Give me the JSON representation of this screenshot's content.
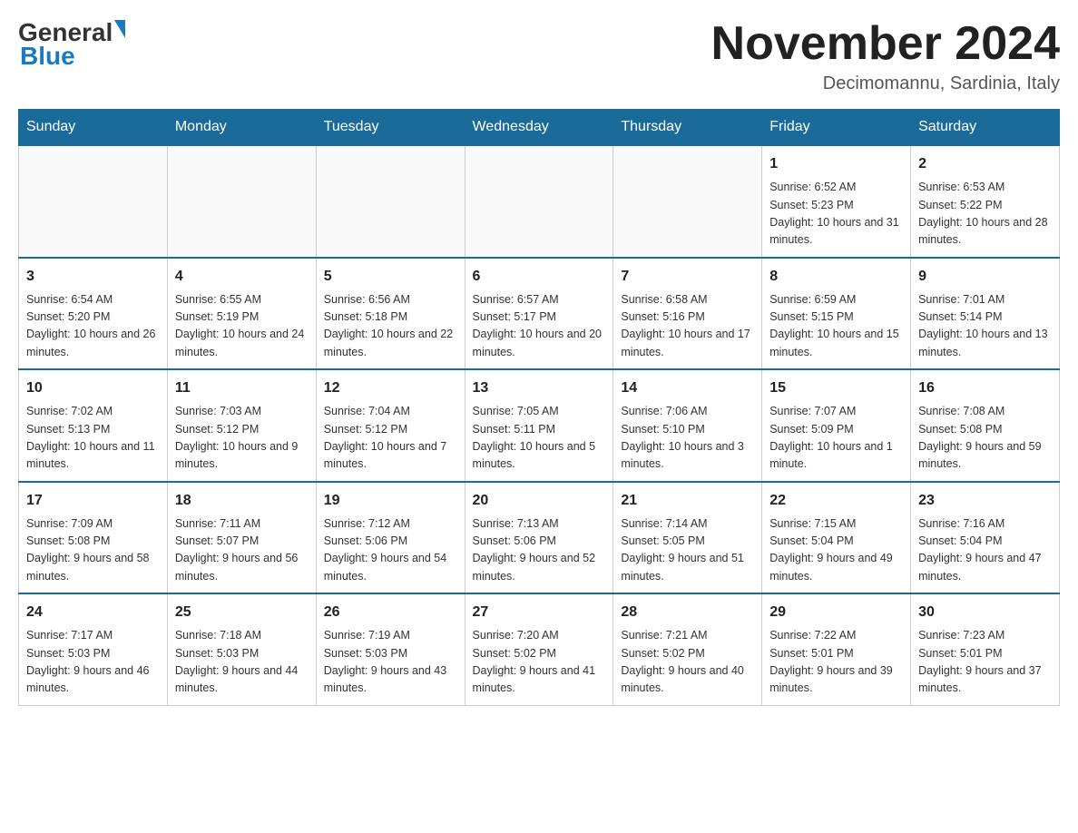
{
  "header": {
    "logo_general": "General",
    "logo_blue": "Blue",
    "month_title": "November 2024",
    "location": "Decimomannu, Sardinia, Italy"
  },
  "weekdays": [
    "Sunday",
    "Monday",
    "Tuesday",
    "Wednesday",
    "Thursday",
    "Friday",
    "Saturday"
  ],
  "weeks": [
    [
      {
        "day": "",
        "empty": true
      },
      {
        "day": "",
        "empty": true
      },
      {
        "day": "",
        "empty": true
      },
      {
        "day": "",
        "empty": true
      },
      {
        "day": "",
        "empty": true
      },
      {
        "day": "1",
        "sunrise": "Sunrise: 6:52 AM",
        "sunset": "Sunset: 5:23 PM",
        "daylight": "Daylight: 10 hours and 31 minutes."
      },
      {
        "day": "2",
        "sunrise": "Sunrise: 6:53 AM",
        "sunset": "Sunset: 5:22 PM",
        "daylight": "Daylight: 10 hours and 28 minutes."
      }
    ],
    [
      {
        "day": "3",
        "sunrise": "Sunrise: 6:54 AM",
        "sunset": "Sunset: 5:20 PM",
        "daylight": "Daylight: 10 hours and 26 minutes."
      },
      {
        "day": "4",
        "sunrise": "Sunrise: 6:55 AM",
        "sunset": "Sunset: 5:19 PM",
        "daylight": "Daylight: 10 hours and 24 minutes."
      },
      {
        "day": "5",
        "sunrise": "Sunrise: 6:56 AM",
        "sunset": "Sunset: 5:18 PM",
        "daylight": "Daylight: 10 hours and 22 minutes."
      },
      {
        "day": "6",
        "sunrise": "Sunrise: 6:57 AM",
        "sunset": "Sunset: 5:17 PM",
        "daylight": "Daylight: 10 hours and 20 minutes."
      },
      {
        "day": "7",
        "sunrise": "Sunrise: 6:58 AM",
        "sunset": "Sunset: 5:16 PM",
        "daylight": "Daylight: 10 hours and 17 minutes."
      },
      {
        "day": "8",
        "sunrise": "Sunrise: 6:59 AM",
        "sunset": "Sunset: 5:15 PM",
        "daylight": "Daylight: 10 hours and 15 minutes."
      },
      {
        "day": "9",
        "sunrise": "Sunrise: 7:01 AM",
        "sunset": "Sunset: 5:14 PM",
        "daylight": "Daylight: 10 hours and 13 minutes."
      }
    ],
    [
      {
        "day": "10",
        "sunrise": "Sunrise: 7:02 AM",
        "sunset": "Sunset: 5:13 PM",
        "daylight": "Daylight: 10 hours and 11 minutes."
      },
      {
        "day": "11",
        "sunrise": "Sunrise: 7:03 AM",
        "sunset": "Sunset: 5:12 PM",
        "daylight": "Daylight: 10 hours and 9 minutes."
      },
      {
        "day": "12",
        "sunrise": "Sunrise: 7:04 AM",
        "sunset": "Sunset: 5:12 PM",
        "daylight": "Daylight: 10 hours and 7 minutes."
      },
      {
        "day": "13",
        "sunrise": "Sunrise: 7:05 AM",
        "sunset": "Sunset: 5:11 PM",
        "daylight": "Daylight: 10 hours and 5 minutes."
      },
      {
        "day": "14",
        "sunrise": "Sunrise: 7:06 AM",
        "sunset": "Sunset: 5:10 PM",
        "daylight": "Daylight: 10 hours and 3 minutes."
      },
      {
        "day": "15",
        "sunrise": "Sunrise: 7:07 AM",
        "sunset": "Sunset: 5:09 PM",
        "daylight": "Daylight: 10 hours and 1 minute."
      },
      {
        "day": "16",
        "sunrise": "Sunrise: 7:08 AM",
        "sunset": "Sunset: 5:08 PM",
        "daylight": "Daylight: 9 hours and 59 minutes."
      }
    ],
    [
      {
        "day": "17",
        "sunrise": "Sunrise: 7:09 AM",
        "sunset": "Sunset: 5:08 PM",
        "daylight": "Daylight: 9 hours and 58 minutes."
      },
      {
        "day": "18",
        "sunrise": "Sunrise: 7:11 AM",
        "sunset": "Sunset: 5:07 PM",
        "daylight": "Daylight: 9 hours and 56 minutes."
      },
      {
        "day": "19",
        "sunrise": "Sunrise: 7:12 AM",
        "sunset": "Sunset: 5:06 PM",
        "daylight": "Daylight: 9 hours and 54 minutes."
      },
      {
        "day": "20",
        "sunrise": "Sunrise: 7:13 AM",
        "sunset": "Sunset: 5:06 PM",
        "daylight": "Daylight: 9 hours and 52 minutes."
      },
      {
        "day": "21",
        "sunrise": "Sunrise: 7:14 AM",
        "sunset": "Sunset: 5:05 PM",
        "daylight": "Daylight: 9 hours and 51 minutes."
      },
      {
        "day": "22",
        "sunrise": "Sunrise: 7:15 AM",
        "sunset": "Sunset: 5:04 PM",
        "daylight": "Daylight: 9 hours and 49 minutes."
      },
      {
        "day": "23",
        "sunrise": "Sunrise: 7:16 AM",
        "sunset": "Sunset: 5:04 PM",
        "daylight": "Daylight: 9 hours and 47 minutes."
      }
    ],
    [
      {
        "day": "24",
        "sunrise": "Sunrise: 7:17 AM",
        "sunset": "Sunset: 5:03 PM",
        "daylight": "Daylight: 9 hours and 46 minutes."
      },
      {
        "day": "25",
        "sunrise": "Sunrise: 7:18 AM",
        "sunset": "Sunset: 5:03 PM",
        "daylight": "Daylight: 9 hours and 44 minutes."
      },
      {
        "day": "26",
        "sunrise": "Sunrise: 7:19 AM",
        "sunset": "Sunset: 5:03 PM",
        "daylight": "Daylight: 9 hours and 43 minutes."
      },
      {
        "day": "27",
        "sunrise": "Sunrise: 7:20 AM",
        "sunset": "Sunset: 5:02 PM",
        "daylight": "Daylight: 9 hours and 41 minutes."
      },
      {
        "day": "28",
        "sunrise": "Sunrise: 7:21 AM",
        "sunset": "Sunset: 5:02 PM",
        "daylight": "Daylight: 9 hours and 40 minutes."
      },
      {
        "day": "29",
        "sunrise": "Sunrise: 7:22 AM",
        "sunset": "Sunset: 5:01 PM",
        "daylight": "Daylight: 9 hours and 39 minutes."
      },
      {
        "day": "30",
        "sunrise": "Sunrise: 7:23 AM",
        "sunset": "Sunset: 5:01 PM",
        "daylight": "Daylight: 9 hours and 37 minutes."
      }
    ]
  ]
}
